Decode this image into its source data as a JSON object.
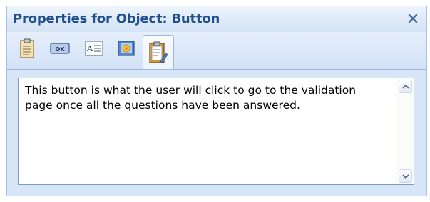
{
  "window": {
    "title": "Properties for Object: Button",
    "close_label": "×"
  },
  "toolbar": {
    "tabs": [
      {
        "icon": "clipboard-icon",
        "selected": false
      },
      {
        "icon": "ok-button-icon",
        "label": "OK",
        "selected": false
      },
      {
        "icon": "text-label-icon",
        "label": "A",
        "selected": false
      },
      {
        "icon": "image-icon",
        "selected": false
      },
      {
        "icon": "notes-clipboard-icon",
        "selected": true
      }
    ]
  },
  "description": {
    "text": "This button is what the user will click to go to the validation page once all the questions have been answered."
  },
  "colors": {
    "title": "#1f4f8c",
    "panel_bg": "#d6e5f8",
    "border": "#a9c3e8"
  }
}
